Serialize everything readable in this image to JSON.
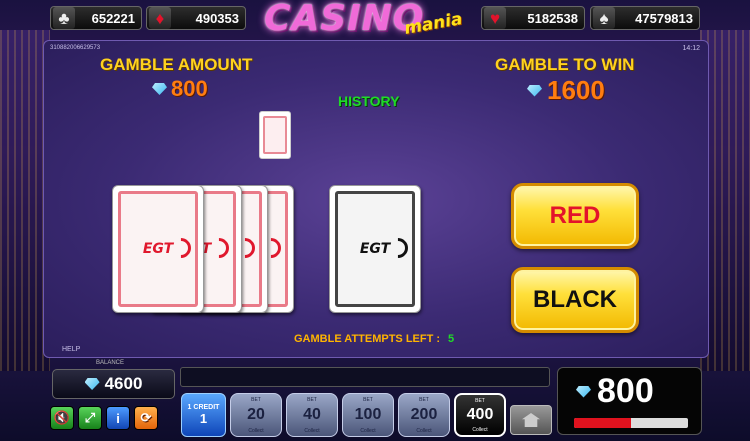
{
  "jackpots": [
    {
      "suit": "clubs-icon",
      "glyph": "♣",
      "value": "652221",
      "color": "#eeeeee"
    },
    {
      "suit": "diamonds-icon",
      "glyph": "♦",
      "value": "490353",
      "color": "#e3132b"
    },
    {
      "suit": "hearts-icon",
      "glyph": "♥",
      "value": "5182538",
      "color": "#e3132b"
    },
    {
      "suit": "spades-icon",
      "glyph": "♠",
      "value": "47579813",
      "color": "#eeeeee"
    }
  ],
  "logo": {
    "main": "CASINO",
    "sub": "mania"
  },
  "panel": {
    "game_id": "310882006629573",
    "clock": "14:12",
    "help": "HELP",
    "gamble_amount_label": "GAMBLE AMOUNT",
    "gamble_amount": "800",
    "gamble_to_win_label": "GAMBLE TO WIN",
    "gamble_to_win": "1600",
    "history_label": "HISTORY",
    "card_brand": "EGT",
    "red_label": "RED",
    "black_label": "BLACK",
    "attempts_label": "GAMBLE ATTEMPTS LEFT :",
    "attempts_left": "5"
  },
  "bottom": {
    "balance_label": "BALANCE",
    "balance": "4600",
    "credit_label": "1 CREDIT",
    "credit_value": "1",
    "bets": [
      {
        "top": "BET",
        "value": "20",
        "bottom": "Collect",
        "active": false
      },
      {
        "top": "BET",
        "value": "40",
        "bottom": "Collect",
        "active": false
      },
      {
        "top": "BET",
        "value": "100",
        "bottom": "Collect",
        "active": false
      },
      {
        "top": "BET",
        "value": "200",
        "bottom": "Collect",
        "active": false
      },
      {
        "top": "BET",
        "value": "400",
        "bottom": "Collect",
        "active": true
      }
    ],
    "win_amount": "800",
    "win_bar_fraction": 0.5
  },
  "colors": {
    "accent_gold": "#ffd21f",
    "win_orange": "#ff7d10",
    "history_green": "#1fdc27",
    "red": "#e3132b"
  }
}
